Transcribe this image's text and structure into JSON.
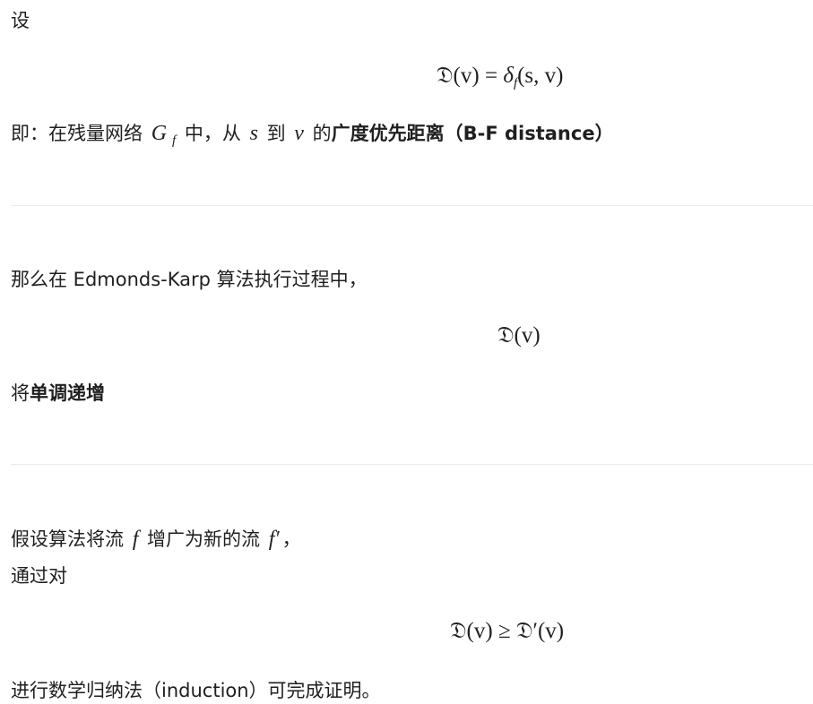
{
  "block1": {
    "intro": "设",
    "formula_lhs": "𝔇(v)",
    "formula_eq": " = ",
    "formula_rhs_delta": "δ",
    "formula_rhs_sub": "f",
    "formula_rhs_args": "(s, v)",
    "line_prefix": "即：在残量网络 ",
    "var_G": "G",
    "var_G_sub": "f",
    "line_mid1": " 中，从 ",
    "var_s": "s",
    "line_mid2": " 到 ",
    "var_v": "v",
    "line_mid3": " 的",
    "bold_term": "广度优先距离（B-F distance）"
  },
  "block2": {
    "intro": "那么在 Edmonds-Karp 算法执行过程中，",
    "formula": "𝔇(v)",
    "line_prefix": "将",
    "bold_term": "单调递增"
  },
  "block3": {
    "line1_prefix": "假设算法将流 ",
    "var_f": "f",
    "line1_mid": " 增广为新的流 ",
    "var_f_prime": "f′",
    "line1_suffix": "，",
    "line2": "通过对",
    "formula_lhs": "𝔇(v)",
    "formula_op": " ≥ ",
    "formula_rhs": "𝔇′(v)",
    "line3": "进行数学归纳法（induction）可完成证明。"
  }
}
